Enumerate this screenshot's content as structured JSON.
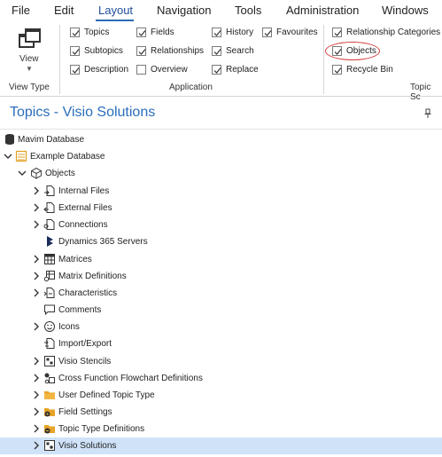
{
  "menu": {
    "items": [
      "File",
      "Edit",
      "Layout",
      "Navigation",
      "Tools",
      "Administration",
      "Windows"
    ],
    "active": "Layout"
  },
  "ribbon": {
    "view_type": {
      "button_label": "View",
      "group_label": "View Type"
    },
    "application": {
      "group_label": "Application",
      "checkboxes": [
        {
          "label": "Topics",
          "checked": true
        },
        {
          "label": "Subtopics",
          "checked": true
        },
        {
          "label": "Description",
          "checked": true
        },
        {
          "label": "Fields",
          "checked": true
        },
        {
          "label": "Relationships",
          "checked": true
        },
        {
          "label": "Overview",
          "checked": false
        },
        {
          "label": "History",
          "checked": true
        },
        {
          "label": "Search",
          "checked": true
        },
        {
          "label": "Replace",
          "checked": true
        },
        {
          "label": "Favourites",
          "checked": true
        }
      ]
    },
    "topic_scope": {
      "group_label": "Topic Sc",
      "checkboxes": [
        {
          "label": "Relationship Categories",
          "checked": true
        },
        {
          "label": "Objects",
          "checked": true
        },
        {
          "label": "Recycle Bin",
          "checked": true
        }
      ]
    },
    "highlight_color": "#d23a3a",
    "accent_color": "#2a6ebb"
  },
  "pane": {
    "title": "Topics -  Visio Solutions"
  },
  "tree": [
    {
      "label": "Mavim Database",
      "icon": "database-icon",
      "expander": "none"
    },
    {
      "label": "Example Database",
      "icon": "example-database-icon",
      "expander": "expanded"
    },
    {
      "label": "Objects",
      "icon": "cube-icon",
      "expander": "expanded"
    },
    {
      "label": "Internal Files",
      "icon": "internal-files-icon",
      "expander": "collapsed"
    },
    {
      "label": "External Files",
      "icon": "external-files-icon",
      "expander": "collapsed"
    },
    {
      "label": "Connections",
      "icon": "connections-icon",
      "expander": "collapsed"
    },
    {
      "label": "Dynamics 365 Servers",
      "icon": "dynamics-365-icon",
      "expander": "none"
    },
    {
      "label": "Matrices",
      "icon": "matrix-icon",
      "expander": "collapsed"
    },
    {
      "label": "Matrix Definitions",
      "icon": "matrix-definitions-icon",
      "expander": "collapsed"
    },
    {
      "label": "Characteristics",
      "icon": "characteristics-icon",
      "expander": "collapsed"
    },
    {
      "label": "Comments",
      "icon": "comment-icon",
      "expander": "none"
    },
    {
      "label": "Icons",
      "icon": "smiley-icon",
      "expander": "collapsed"
    },
    {
      "label": "Import/Export",
      "icon": "import-export-icon",
      "expander": "none"
    },
    {
      "label": "Visio Stencils",
      "icon": "visio-stencils-icon",
      "expander": "collapsed"
    },
    {
      "label": "Cross Function Flowchart Definitions",
      "icon": "flowchart-definitions-icon",
      "expander": "collapsed"
    },
    {
      "label": "User Defined Topic Type",
      "icon": "folder-icon",
      "expander": "collapsed"
    },
    {
      "label": "Field Settings",
      "icon": "field-settings-icon",
      "expander": "collapsed"
    },
    {
      "label": "Topic Type Definitions",
      "icon": "topic-type-definitions-icon",
      "expander": "collapsed"
    },
    {
      "label": "Visio Solutions",
      "icon": "visio-solutions-icon",
      "expander": "collapsed",
      "selected": true
    }
  ]
}
